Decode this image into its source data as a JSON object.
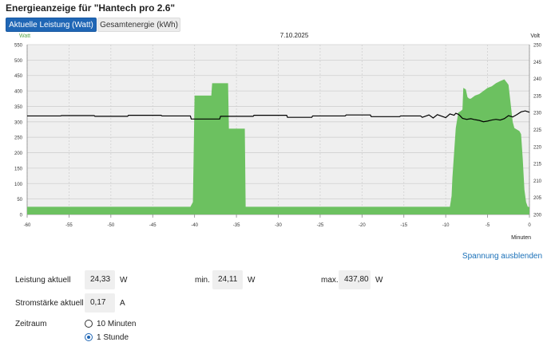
{
  "page": {
    "title": "Energieanzeige für \"Hantech pro 2.6\""
  },
  "tabs": [
    {
      "label": "Aktuelle Leistung (Watt)",
      "active": true
    },
    {
      "label": "Gesamtenergie (kWh)",
      "active": false
    }
  ],
  "chart_data": {
    "type": "area",
    "title": "7.10.2025",
    "xlabel": "Minuten",
    "ylabel_left": "Watt",
    "ylabel_right": "Volt",
    "xlim": [
      -60,
      0
    ],
    "ylim_left": [
      0,
      550
    ],
    "ylim_right": [
      200,
      250
    ],
    "x_ticks": [
      -60,
      -55,
      -50,
      -45,
      -40,
      -35,
      -30,
      -25,
      -20,
      -15,
      -10,
      -5,
      0
    ],
    "y_ticks_left": [
      0,
      50,
      100,
      150,
      200,
      250,
      300,
      350,
      400,
      450,
      500,
      550
    ],
    "y_ticks_right": [
      200,
      205,
      210,
      215,
      220,
      225,
      230,
      235,
      240,
      245,
      250
    ],
    "grid": true,
    "colors": {
      "power": "#6cc160",
      "voltage": "#000000",
      "left_axis_label": "#5aa84f"
    },
    "series": [
      {
        "axis": "left",
        "style": "area",
        "x": [
          -60,
          -40.5,
          -40.2,
          -40,
          -38,
          -37.9,
          -36,
          -35.9,
          -34,
          -33.9,
          -9.5,
          -9.3,
          -9.2,
          -8.8,
          -8.5,
          -8.2,
          -8,
          -7.9,
          -7.6,
          -7.4,
          -7.2,
          -7,
          -6.5,
          -6,
          -5.5,
          -5,
          -4.5,
          -4,
          -3.5,
          -3,
          -2.5,
          -2,
          -1.8,
          -1.5,
          -1.2,
          -1,
          -0.8,
          -0.6,
          -0.4,
          -0.2,
          0
        ],
        "y": [
          25,
          25,
          40,
          385,
          385,
          425,
          425,
          278,
          278,
          25,
          25,
          60,
          120,
          280,
          330,
          335,
          340,
          410,
          405,
          380,
          375,
          375,
          385,
          390,
          400,
          410,
          415,
          425,
          432,
          437.8,
          420,
          300,
          280,
          275,
          270,
          260,
          180,
          80,
          40,
          25,
          24.33
        ]
      },
      {
        "axis": "right",
        "style": "line",
        "x": [
          -60,
          -56,
          -55.9,
          -52,
          -51.9,
          -48,
          -47.9,
          -44,
          -43.9,
          -40.5,
          -40.4,
          -37,
          -36.9,
          -33,
          -32.9,
          -29,
          -28.9,
          -26,
          -25.9,
          -22,
          -21.9,
          -19,
          -18.9,
          -15.5,
          -15.4,
          -13,
          -12.8,
          -12,
          -11.5,
          -11,
          -10,
          -9.5,
          -9,
          -8.8,
          -8.5,
          -8.3,
          -8,
          -7.5,
          -7,
          -6.5,
          -6,
          -5.5,
          -5,
          -4.5,
          -4,
          -3.5,
          -3,
          -2.5,
          -2,
          -1.5,
          -1,
          -0.5,
          0
        ],
        "y": [
          229,
          229,
          229.1,
          229.1,
          228.9,
          228.9,
          229.2,
          229.2,
          229,
          229,
          228.1,
          228.1,
          228.9,
          228.9,
          229.2,
          229.2,
          228.6,
          228.6,
          229,
          229,
          229.3,
          229.3,
          228.8,
          228.8,
          229,
          229,
          228.6,
          229.3,
          228.4,
          229.4,
          228.5,
          229.6,
          229.2,
          229.8,
          229.5,
          229.1,
          228.3,
          228,
          228.2,
          227.9,
          227.7,
          227.3,
          227.5,
          227.8,
          228,
          227.8,
          228.2,
          229.1,
          228.7,
          229.4,
          230.2,
          230.5,
          230.1
        ]
      }
    ]
  },
  "controls": {
    "spannung_link": "Spannung ausblenden",
    "leistung": {
      "label": "Leistung aktuell",
      "value": "24,33",
      "unit": "W"
    },
    "min": {
      "label": "min.",
      "value": "24,11",
      "unit": "W"
    },
    "max": {
      "label": "max.",
      "value": "437,80",
      "unit": "W"
    },
    "strom": {
      "label": "Stromstärke aktuell",
      "value": "0,17",
      "unit": "A"
    },
    "zeitraum": {
      "label": "Zeitraum",
      "options": [
        {
          "label": "10 Minuten",
          "selected": false
        },
        {
          "label": "1 Stunde",
          "selected": true
        }
      ]
    }
  }
}
